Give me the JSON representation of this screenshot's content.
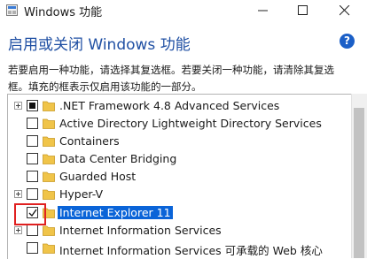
{
  "window": {
    "title": "Windows 功能"
  },
  "header": {
    "title": "启用或关闭 Windows 功能",
    "help_glyph": "?",
    "description_line1": "若要启用一种功能，请选择其复选框。若要关闭一种功能，请清除其复选",
    "description_line2": "框。填充的框表示仅启用该功能的一部分。"
  },
  "colors": {
    "accent": "#1f4fa3",
    "selection": "#0a64d8",
    "folder": "#f0c449",
    "highlight_box": "#e02020"
  },
  "features": [
    {
      "label": ".NET Framework 4.8 Advanced Services",
      "state": "partial",
      "expandable": true
    },
    {
      "label": "Active Directory Lightweight Directory Services",
      "state": "unchecked",
      "expandable": false
    },
    {
      "label": "Containers",
      "state": "unchecked",
      "expandable": false
    },
    {
      "label": "Data Center Bridging",
      "state": "unchecked",
      "expandable": false
    },
    {
      "label": "Guarded Host",
      "state": "unchecked",
      "expandable": false
    },
    {
      "label": "Hyper-V",
      "state": "unchecked",
      "expandable": true
    },
    {
      "label": "Internet Explorer 11",
      "state": "checked",
      "expandable": false,
      "selected": true
    },
    {
      "label": "Internet Information Services",
      "state": "unchecked",
      "expandable": true
    },
    {
      "label": "Internet Information Services 可承载的 Web 核心",
      "state": "unchecked",
      "expandable": false
    }
  ]
}
